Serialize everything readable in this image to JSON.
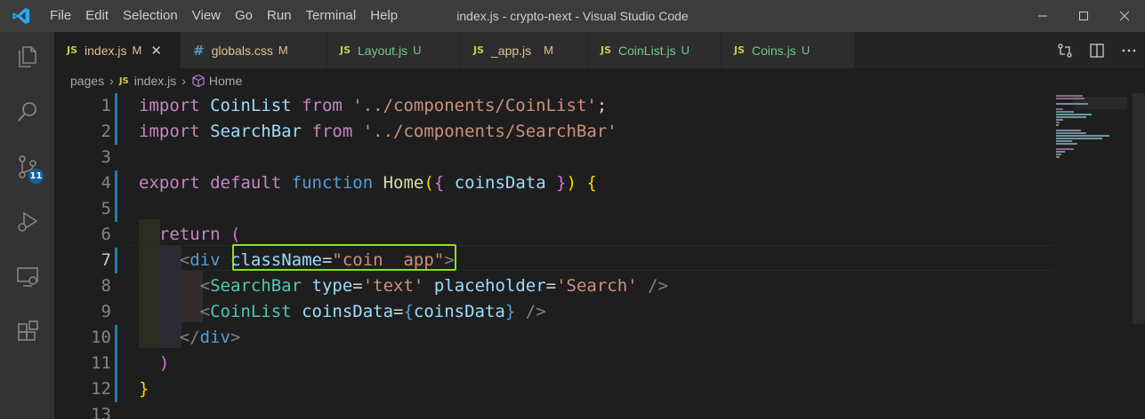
{
  "window": {
    "title": "index.js - crypto-next - Visual Studio Code",
    "menu": [
      "File",
      "Edit",
      "Selection",
      "View",
      "Go",
      "Run",
      "Terminal",
      "Help"
    ]
  },
  "activity_bar": {
    "items": [
      "explorer-icon",
      "search-icon",
      "source-control-icon",
      "run-debug-icon",
      "remote-explorer-icon",
      "extensions-icon"
    ],
    "scm_badge": "11"
  },
  "tabs": [
    {
      "icon": "JS",
      "name": "index.js",
      "status": "M",
      "active": true,
      "name_color": "#e2c08d",
      "status_color": "#e2c08d"
    },
    {
      "icon": "#",
      "name": "globals.css",
      "status": "M",
      "active": false,
      "name_color": "#e2c08d",
      "status_color": "#e2c08d"
    },
    {
      "icon": "JS",
      "name": "Layout.js",
      "status": "U",
      "active": false,
      "name_color": "#73c991",
      "status_color": "#73c991"
    },
    {
      "icon": "JS",
      "name": "_app.js",
      "status": "M",
      "active": false,
      "name_color": "#e2c08d",
      "status_color": "#e2c08d"
    },
    {
      "icon": "JS",
      "name": "CoinList.js",
      "status": "U",
      "active": false,
      "name_color": "#73c991",
      "status_color": "#73c991"
    },
    {
      "icon": "JS",
      "name": "Coins.js",
      "status": "U",
      "active": false,
      "name_color": "#73c991",
      "status_color": "#73c991"
    }
  ],
  "breadcrumb": {
    "folder": "pages",
    "file_icon": "JS",
    "file": "index.js",
    "symbol": "Home"
  },
  "editor": {
    "current_line": 7,
    "line_numbers": [
      "1",
      "2",
      "3",
      "4",
      "5",
      "6",
      "7",
      "8",
      "9",
      "10",
      "11",
      "12",
      "13"
    ]
  },
  "colors": {
    "accent": "#007acc",
    "highlight_box": "#86e126",
    "modified": "#e2c08d",
    "untracked": "#73c991"
  }
}
